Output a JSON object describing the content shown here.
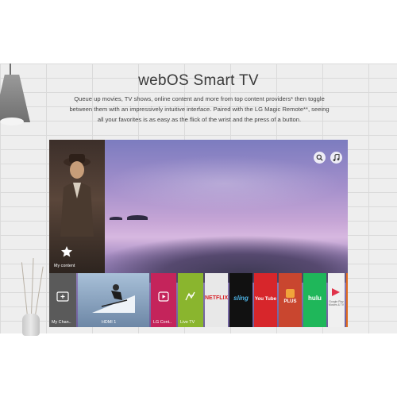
{
  "heading": {
    "title": "webOS Smart TV",
    "blurb": "Queue up movies, TV shows, online content and more from top content providers* then toggle between them with an impressively intuitive interface. Paired with the LG Magic Remote**, seeing all your favorites is as easy as the flick of the wrist and the press of a button."
  },
  "tv": {
    "featured": {
      "label": "My content",
      "icon": "star-icon"
    },
    "top_buttons": [
      {
        "icon": "search-icon"
      },
      {
        "icon": "music-note-icon"
      }
    ],
    "launcher": [
      {
        "label": "My Chan..",
        "icon": "tv-plus-icon",
        "color": "#5a5a5a"
      },
      {
        "label": "HDMI 1",
        "icon": "",
        "color": "#6d87a6"
      },
      {
        "label": "LG Cont..",
        "icon": "play-box-icon",
        "color": "#c4245b"
      },
      {
        "label": "Live TV",
        "icon": "antenna-icon",
        "color": "#8ab52e"
      },
      {
        "label": "",
        "logo": "NETFLIX",
        "color": "#e8e8e8"
      },
      {
        "label": "",
        "logo": "sling",
        "color": "#111111"
      },
      {
        "label": "",
        "logo": "You Tube",
        "color": "#d7262b"
      },
      {
        "label": "",
        "logo": "PLUS",
        "color": "#c9462f"
      },
      {
        "label": "",
        "logo": "hulu",
        "color": "#1fb75a"
      },
      {
        "label": "",
        "logo": "Google Play Movies & TV",
        "color": "#f0f0f0"
      },
      {
        "label": "",
        "logo": "",
        "color": "#e06a1e"
      }
    ]
  }
}
